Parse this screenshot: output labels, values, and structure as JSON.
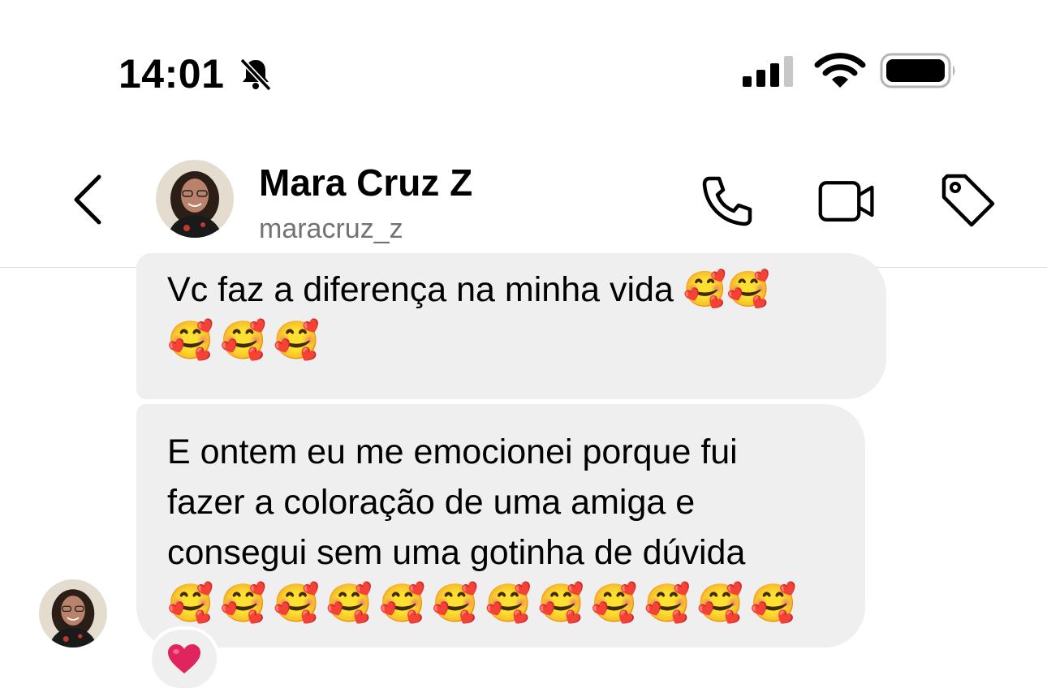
{
  "status_bar": {
    "time": "14:01",
    "icons": [
      "bell-slash-icon",
      "signal-icon",
      "wifi-icon",
      "battery-icon"
    ]
  },
  "header": {
    "name": "Mara Cruz Z",
    "username": "maracruz_z",
    "actions": [
      "phone-icon",
      "video-icon",
      "tag-icon"
    ]
  },
  "messages": [
    {
      "lines": [
        "Vc faz a diferença na minha vida 🥰🥰",
        "🥰🥰🥰"
      ]
    },
    {
      "lines": [
        "E ontem eu me emocionei porque fui",
        "fazer a coloração de uma amiga e",
        "consegui sem uma gotinha de dúvida",
        "🥰🥰🥰🥰🥰🥰🥰🥰🥰🥰🥰🥰"
      ],
      "reaction": "❤️"
    }
  ],
  "colors": {
    "bubble": "#efefef",
    "secondary_text": "#737373",
    "divider": "#dbdbdb",
    "heart": "#e0245e"
  }
}
